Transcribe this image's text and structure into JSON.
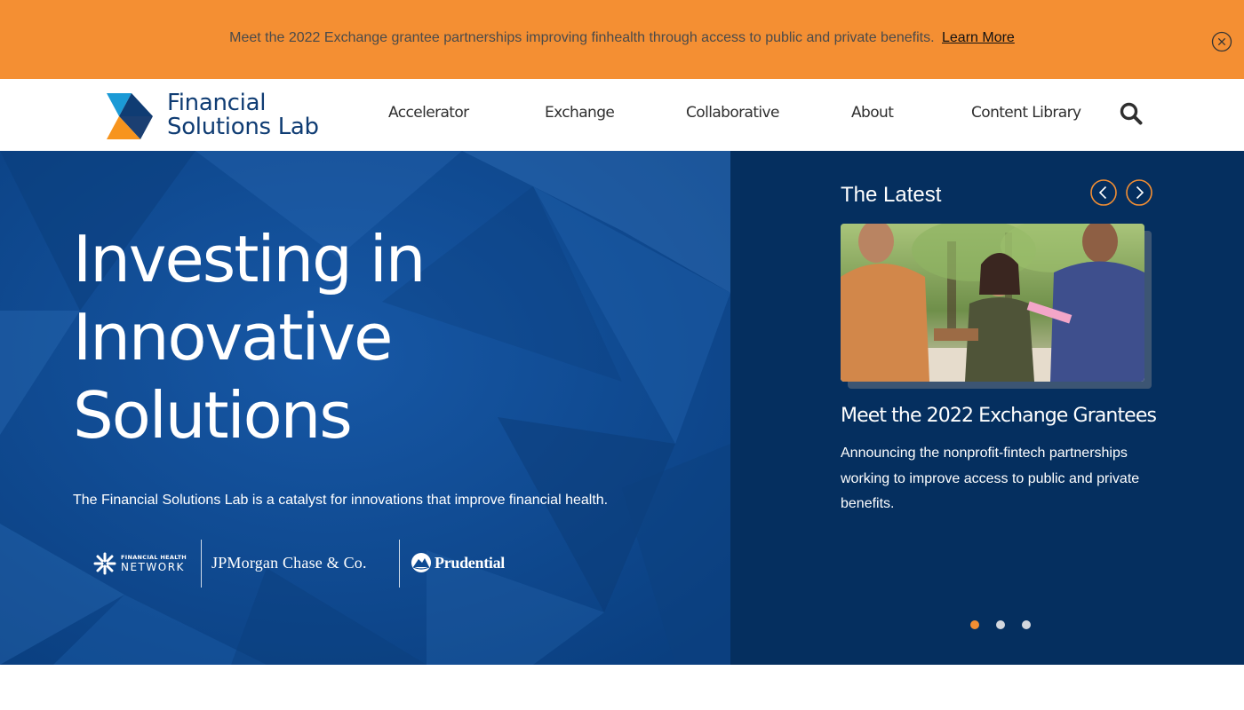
{
  "announcement": {
    "text": "Meet the 2022 Exchange grantee partnerships improving finhealth through access to public and private benefits.",
    "link_label": "Learn More",
    "background_color": "#f48f33",
    "close_icon": "close-circle-icon"
  },
  "header": {
    "logo": {
      "line1": "Financial",
      "line2": "Solutions Lab",
      "colors": [
        "#f7941d",
        "#1b9ad6",
        "#0f3c73"
      ]
    },
    "nav": [
      {
        "label": "Accelerator"
      },
      {
        "label": "Exchange"
      },
      {
        "label": "Collaborative"
      },
      {
        "label": "About"
      },
      {
        "label": "Content Library"
      }
    ],
    "search_icon": "search-icon"
  },
  "hero": {
    "title_lines": [
      "Investing in",
      "Innovative",
      "Solutions"
    ],
    "subtitle": "The Financial Solutions Lab is a catalyst for innovations that improve financial health.",
    "partners": {
      "fhn_small": "FINANCIAL HEALTH",
      "fhn_big": "NETWORK",
      "jpm": "JPMorgan Chase & Co.",
      "prudential": "Prudential"
    },
    "background_color": "#0d4a92"
  },
  "latest": {
    "title": "The Latest",
    "prev_icon": "chevron-left-icon",
    "next_icon": "chevron-right-icon",
    "card": {
      "title": "Meet the 2022 Exchange Grantees",
      "description": "Announcing the nonprofit-fintech partnerships working to improve access to public and private benefits."
    },
    "slides_total": 3,
    "active_slide": 1,
    "accent_color": "#f48f33",
    "background_color": "#052f5f"
  }
}
